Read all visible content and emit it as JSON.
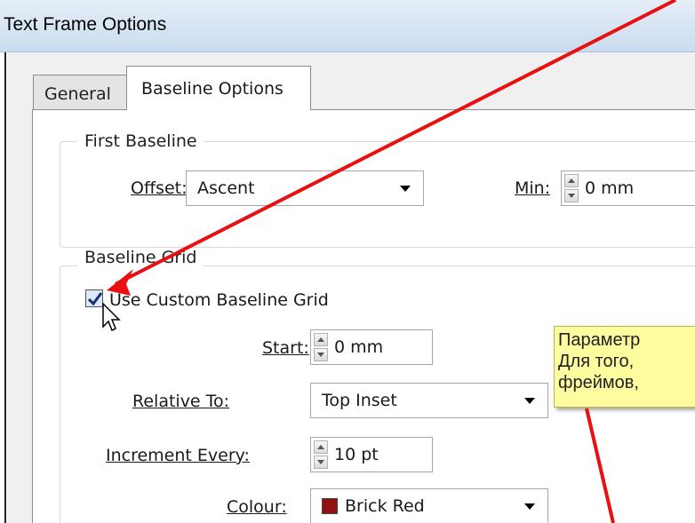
{
  "window": {
    "title": "Text Frame Options"
  },
  "tabs": [
    {
      "label": "General"
    },
    {
      "label": "Baseline Options"
    }
  ],
  "first_baseline": {
    "title": "First Baseline",
    "offset_label": "Offset:",
    "offset_value": "Ascent",
    "min_label": "Min:",
    "min_value": "0 mm"
  },
  "baseline_grid": {
    "title": "Baseline Grid",
    "use_custom_label": "Use Custom Baseline Grid",
    "use_custom_checked": true,
    "start_label": "Start:",
    "start_value": "0 mm",
    "relative_to_label": "Relative To:",
    "relative_to_value": "Top Inset",
    "increment_label": "Increment Every:",
    "increment_value": "10 pt",
    "colour_label": "Colour:",
    "colour_value": "Brick Red",
    "colour_swatch": "#8f1111"
  },
  "tooltip": {
    "lines": [
      "Параметр",
      "Для того,",
      "фреймов,"
    ]
  },
  "annotation": {
    "arrow_color": "#e81010"
  }
}
